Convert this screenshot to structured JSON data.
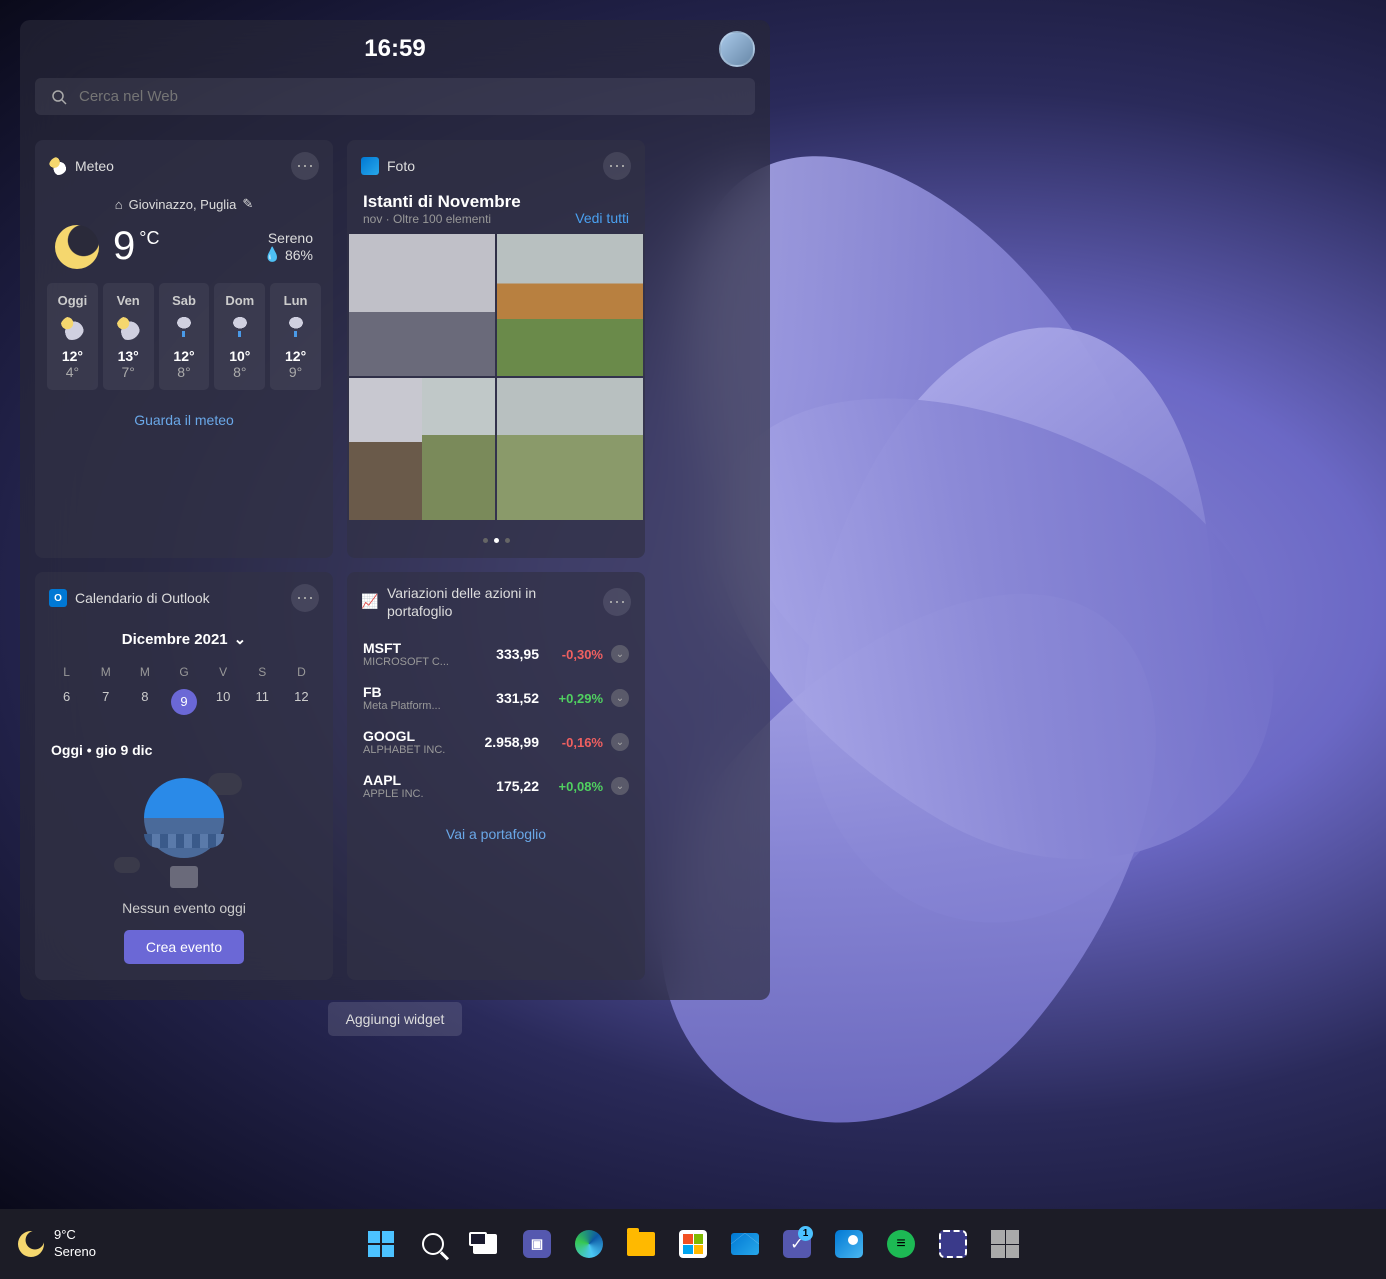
{
  "panel": {
    "time": "16:59",
    "search_placeholder": "Cerca nel Web",
    "add_widget_label": "Aggiungi widget"
  },
  "weather": {
    "title": "Meteo",
    "location": "Giovinazzo, Puglia",
    "temp": "9",
    "unit": "°C",
    "condition": "Sereno",
    "humidity": "86%",
    "link": "Guarda il meteo",
    "forecast": [
      {
        "day": "Oggi",
        "hi": "12°",
        "lo": "4°"
      },
      {
        "day": "Ven",
        "hi": "13°",
        "lo": "7°"
      },
      {
        "day": "Sab",
        "hi": "12°",
        "lo": "8°"
      },
      {
        "day": "Dom",
        "hi": "10°",
        "lo": "8°"
      },
      {
        "day": "Lun",
        "hi": "12°",
        "lo": "9°"
      }
    ]
  },
  "calendar": {
    "title": "Calendario di Outlook",
    "month": "Dicembre 2021",
    "headers": [
      "L",
      "M",
      "M",
      "G",
      "V",
      "S",
      "D"
    ],
    "days": [
      "6",
      "7",
      "8",
      "9",
      "10",
      "11",
      "12"
    ],
    "today_index": 3,
    "today_label": "Oggi • gio 9 dic",
    "empty_text": "Nessun evento oggi",
    "create_label": "Crea evento"
  },
  "photos": {
    "title": "Foto",
    "headline": "Istanti di Novembre",
    "subtitle": "nov · Oltre 100 elementi",
    "link": "Vedi tutti"
  },
  "stocks": {
    "title": "Variazioni delle azioni in portafoglio",
    "link": "Vai a portafoglio",
    "rows": [
      {
        "sym": "MSFT",
        "co": "MICROSOFT C...",
        "price": "333,95",
        "change": "-0,30%",
        "dir": "down"
      },
      {
        "sym": "FB",
        "co": "Meta Platform...",
        "price": "331,52",
        "change": "+0,29%",
        "dir": "up"
      },
      {
        "sym": "GOOGL",
        "co": "ALPHABET INC.",
        "price": "2.958,99",
        "change": "-0,16%",
        "dir": "down"
      },
      {
        "sym": "AAPL",
        "co": "APPLE INC.",
        "price": "175,22",
        "change": "+0,08%",
        "dir": "up"
      }
    ]
  },
  "taskbar": {
    "temp": "9°C",
    "condition": "Sereno",
    "todo_badge": "1"
  }
}
